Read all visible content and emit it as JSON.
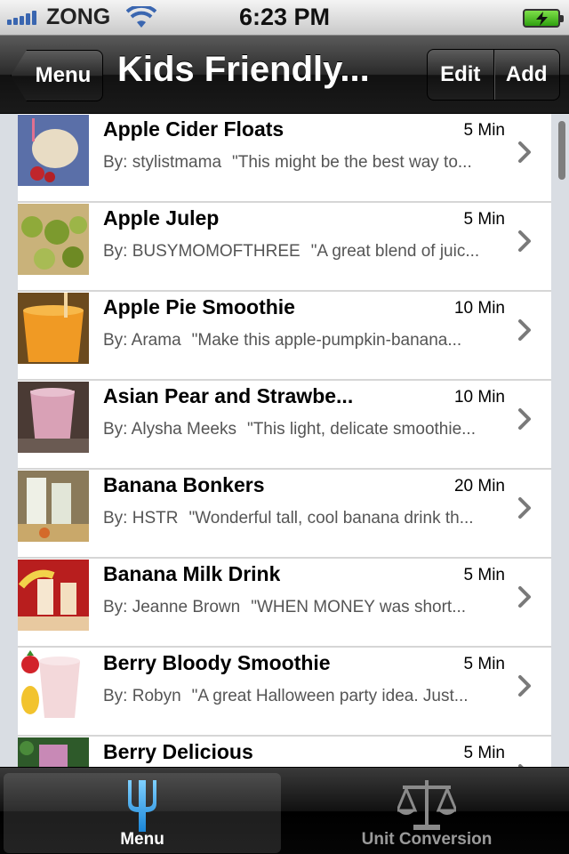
{
  "status_bar": {
    "carrier": "ZONG",
    "time": "6:23 PM"
  },
  "nav": {
    "back_label": "Menu",
    "title": "Kids Friendly...",
    "edit_label": "Edit",
    "add_label": "Add"
  },
  "recipes": [
    {
      "title": "Apple Cider Floats",
      "time": "5 Min",
      "author": "By: stylistmama",
      "snippet": "\"This might be the best way to..."
    },
    {
      "title": "Apple Julep",
      "time": "5 Min",
      "author": "By: BUSYMOMOFTHREE",
      "snippet": "\"A great blend of juic..."
    },
    {
      "title": "Apple Pie Smoothie",
      "time": "10 Min",
      "author": "By: Arama",
      "snippet": "\"Make this apple-pumpkin-banana..."
    },
    {
      "title": "Asian Pear and Strawbe...",
      "time": "10 Min",
      "author": "By: Alysha Meeks",
      "snippet": "\"This light, delicate smoothie..."
    },
    {
      "title": "Banana Bonkers",
      "time": "20 Min",
      "author": "By: HSTR",
      "snippet": "\"Wonderful tall, cool banana drink th..."
    },
    {
      "title": "Banana Milk Drink",
      "time": "5 Min",
      "author": "By: Jeanne Brown",
      "snippet": "\"WHEN MONEY was short..."
    },
    {
      "title": "Berry Bloody Smoothie",
      "time": "5 Min",
      "author": "By: Robyn",
      "snippet": "\"A great Halloween party idea. Just..."
    },
    {
      "title": "Berry Delicious",
      "time": "5 Min",
      "author": "",
      "snippet": ""
    }
  ],
  "tabs": [
    {
      "label": "Menu",
      "icon": "fork-icon",
      "selected": true
    },
    {
      "label": "Unit Conversion",
      "icon": "scale-icon",
      "selected": false
    }
  ],
  "colors": {
    "battery": "#2fa10f",
    "signal": "#3a66b0",
    "tab_active_icon": "#3fa9f5"
  }
}
